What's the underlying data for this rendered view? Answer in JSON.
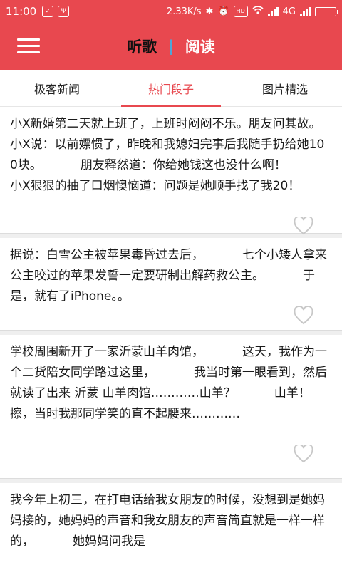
{
  "status_bar": {
    "time": "11:00",
    "speed": "2.33K/s",
    "network": "4G",
    "icons": [
      "shield-icon",
      "usb-icon",
      "bluetooth-icon",
      "alarm-icon",
      "hd-icon",
      "wifi-icon",
      "signal-icon",
      "battery-icon"
    ],
    "hd_label": "HD",
    "battery_level": 0.85
  },
  "header": {
    "menu_icon": "hamburger-menu-icon",
    "switch": {
      "active": "听歌",
      "separator": "|",
      "inactive": "阅读"
    }
  },
  "tabs": [
    {
      "label": "极客新闻",
      "active": false
    },
    {
      "label": "热门段子",
      "active": true
    },
    {
      "label": "图片精选",
      "active": false
    }
  ],
  "feed": {
    "like_icon": "heart-outline-icon",
    "items": [
      {
        "text": "小X新婚第二天就上班了，上班时闷闷不乐。朋友问其故。 小X说：以前嫖惯了，昨晚和我媳妇完事后我随手扔给她100块。          朋友释然道：你给她钱这也没什么啊！          小X狠狠的抽了口烟懊恼道：问题是她顺手找了我20！"
      },
      {
        "text": "据说：白雪公主被苹果毒昏过去后，          七个小矮人拿来公主咬过的苹果发誓一定要研制出解药救公主。          于是，就有了iPhone。。"
      },
      {
        "text": "学校周围新开了一家沂蒙山羊肉馆，          这天，我作为一个二货陪女同学路过这里，          我当时第一眼看到，然后就读了出来 沂蒙 山羊肉馆…………山羊？          山羊！擦，当时我那同学笑的直不起腰来…………"
      },
      {
        "text": "我今年上初三，在打电话给我女朋友的时候，没想到是她妈妈接的，她妈妈的声音和我女朋友的声音简直就是一样一样的，          她妈妈问我是"
      }
    ]
  },
  "colors": {
    "primary": "#e8484f",
    "separator": "#4ea6d8",
    "heart": "#c8c8c8"
  }
}
